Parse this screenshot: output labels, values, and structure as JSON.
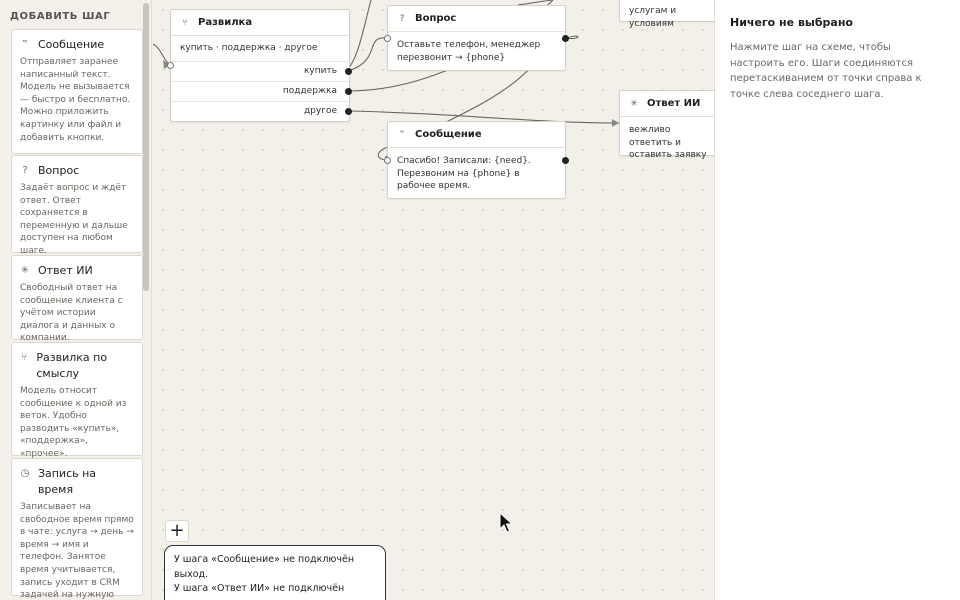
{
  "sidebar": {
    "title": "ДОБАВИТЬ ШАГ",
    "items": [
      {
        "icon": "quote-icon",
        "glyph": "‟",
        "title": "Сообщение",
        "desc": "Отправляет заранее написанный текст. Модель не вызывается — быстро и бесплатно. Можно приложить картинку или файл и добавить кнопки."
      },
      {
        "icon": "question-icon",
        "glyph": "?",
        "title": "Вопрос",
        "desc": "Задаёт вопрос и ждёт ответ. Ответ сохраняется в переменную и дальше доступен на любом шаге."
      },
      {
        "icon": "sparkle-icon",
        "glyph": "✳",
        "title": "Ответ ИИ",
        "desc": "Свободный ответ на сообщение клиента с учётом истории диалога и данных о компании."
      },
      {
        "icon": "fork-icon",
        "glyph": "⑂",
        "title": "Развилка по смыслу",
        "desc": "Модель относит сообщение к одной из веток. Удобно разводить «купить», «поддержка», «прочее»."
      },
      {
        "icon": "clock-icon",
        "glyph": "◷",
        "title": "Запись на время",
        "desc": "Записывает на свободное время прямо в чате: услуга → день → время → имя и телефон. Занятое время учитывается, запись уходит в CRM задачей на нужную дату."
      }
    ]
  },
  "canvas": {
    "nodes": {
      "fork": {
        "glyph": "⑂",
        "title": "Развилка",
        "body": "купить · поддержка · другое",
        "branches": [
          "купить",
          "поддержка",
          "другое"
        ]
      },
      "question": {
        "glyph": "?",
        "title": "Вопрос",
        "body": "Оставьте телефон, менеджер перезвонит → {phone}"
      },
      "message": {
        "glyph": "‟",
        "title": "Сообщение",
        "body": "Спасибо! Записали: {need}. Перезвоним на {phone} в рабочее время."
      },
      "ai": {
        "glyph": "✳",
        "title": "Ответ ИИ",
        "body": "вежливо ответить и оставить заявку"
      },
      "partial": {
        "body": "услугам и условиям"
      }
    },
    "add_label": "+",
    "warnings": [
      "У шага «Сообщение» не подключён выход.",
      "У шага «Ответ ИИ» не подключён выход."
    ]
  },
  "panel": {
    "title": "Ничего не выбрано",
    "text": "Нажмите шаг на схеме, чтобы настроить его. Шаги соединяются перетаскиванием от точки справа к точке слева соседнего шага."
  }
}
